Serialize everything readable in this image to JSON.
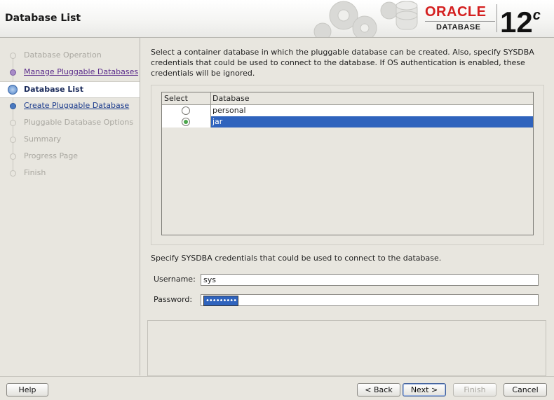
{
  "header": {
    "title": "Database List",
    "logo": {
      "brand": "ORACLE",
      "product": "DATABASE",
      "version": "12",
      "version_suffix": "c"
    }
  },
  "nav": {
    "items": [
      {
        "label": "Database Operation",
        "state": "disabled"
      },
      {
        "label": "Manage Pluggable Databases",
        "state": "visited"
      },
      {
        "label": "Database List",
        "state": "current"
      },
      {
        "label": "Create Pluggable Database",
        "state": "link"
      },
      {
        "label": "Pluggable Database Options",
        "state": "disabled"
      },
      {
        "label": "Summary",
        "state": "disabled"
      },
      {
        "label": "Progress Page",
        "state": "disabled"
      },
      {
        "label": "Finish",
        "state": "disabled"
      }
    ]
  },
  "main": {
    "intro": "Select a container database in which the pluggable database can be created. Also, specify SYSDBA credentials that could be used to connect to the database. If OS authentication is enabled, these credentials will be ignored.",
    "table": {
      "columns": [
        "Select",
        "Database"
      ],
      "rows": [
        {
          "database": "personal",
          "selected": false
        },
        {
          "database": "jar",
          "selected": true
        }
      ]
    },
    "credentials_note": "Specify SYSDBA credentials that could be used to connect to the database.",
    "username_label": "Username:",
    "username_value": "sys",
    "password_label": "Password:",
    "password_mask": "•••••••••"
  },
  "footer": {
    "help": "Help",
    "back": "< Back",
    "next": "Next >",
    "finish": "Finish",
    "cancel": "Cancel"
  },
  "colors": {
    "oracle_red": "#d41f1f",
    "selection_blue": "#2f63bd",
    "panel_bg": "#e8e6df"
  }
}
